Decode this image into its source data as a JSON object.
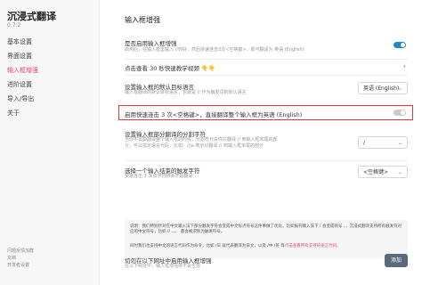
{
  "sidebar": {
    "brand": "沉浸式翻译",
    "version": "0.7.2",
    "items": [
      {
        "label": "基本设置"
      },
      {
        "label": "界面设置"
      },
      {
        "label": "输入框增强"
      },
      {
        "label": "进阶设置"
      },
      {
        "label": "导入/导出"
      },
      {
        "label": "关于"
      }
    ],
    "footer": [
      "问题反馈加群",
      "文档",
      "开发者设置"
    ]
  },
  "main": {
    "title": "输入框增强",
    "enable": {
      "label": "是否启用输入框增强",
      "desc": "启用后，在输入框里输入 //你好，然后快速连击3次<空格键>，即可翻译为 英语 (English)"
    },
    "video_link": "点击查看 30 秒快速教学视频 👇👇",
    "target_lang": {
      "label": "设置输入框的默认目标语言",
      "desc1": "输入框翻译的默认目标语言，也就是 // 作为触发词的默认语言",
      "value": "英语 (English)"
    },
    "quick_triple": {
      "label": "启用快速连击 3 次<空格键>，直接翻译整个输入框为英语 (English)"
    },
    "separator": {
      "label": "设置输入框部分翻译的分割字符",
      "desc1": "当你不需要翻译整个输入框的时候，分割符允许你只翻译 // 到输入框末尾的部",
      "desc2": "分，可以指定语言代码，比如：//ja 表示只翻译 // 到输入框末尾的部分",
      "value": "/"
    },
    "trigger": {
      "label": "选择一个输入结束的触发字符",
      "desc": "快速连击 3 次该字符将会开始翻译",
      "value": "<空格键>"
    },
    "note": {
      "p1": "说明：我们特别针对在中文输入法下部分触发字符会变成中文标点符号这件事做了优化，比如报刊输入法下 / 会变成顿号 、，沉浸式翻译支持所有触发符对应的中文符号，比如 // 、、、 都会被识别为触发符号。",
      "p2": "同时我们也支持中文的语言代码作为命令，比如 /日 就代表翻译为日文，以及 /中 /英 等",
      "link": "点击查看所有支持的语言代码。"
    },
    "disable_site": {
      "label": "切勿在以下网址中启用输入框增强",
      "desc": "在以下网址中，输入框增强将不会生效",
      "button": "添加"
    }
  },
  "colors": {
    "accent": "#e8467c",
    "toggle_on": "#1e88c8",
    "highlight_border": "#e03b2f",
    "button_bg": "#5a6a7a"
  }
}
